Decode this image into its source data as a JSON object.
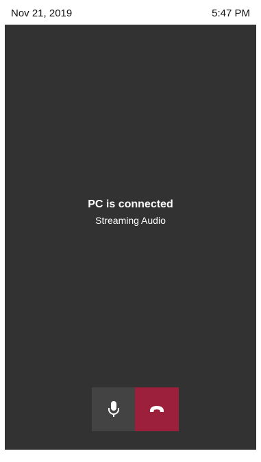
{
  "status_bar": {
    "date": "Nov 21, 2019",
    "time": "5:47 PM"
  },
  "call": {
    "title": "PC is connected",
    "subtitle": "Streaming Audio"
  },
  "controls": {
    "mic_icon": "microphone-icon",
    "hangup_icon": "phone-hangup-icon"
  },
  "colors": {
    "background": "#333232",
    "mic_button": "#434343",
    "hangup_button": "#9c1f3b",
    "text": "#ffffff"
  }
}
